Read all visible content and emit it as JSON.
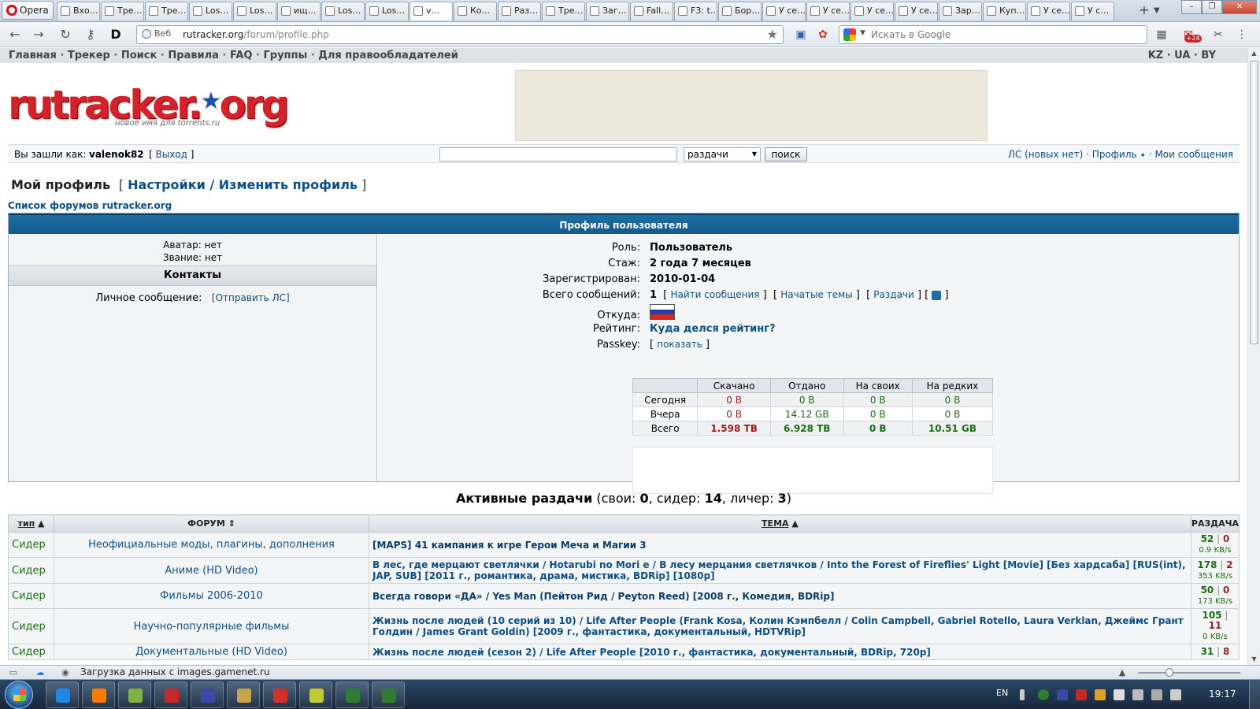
{
  "browser": {
    "menu_label": "Opera",
    "tabs": [
      "Вхо…",
      "Тре…",
      "Тре…",
      "Los…",
      "Los…",
      "ищ…",
      "Los…",
      "Los…",
      "v…",
      "Ко…",
      "Раз…",
      "Тре…",
      "Заг…",
      "Fall…",
      "F3: t…",
      "Бор…",
      "У се…",
      "У се…",
      "У се…",
      "У се…",
      "Зар…",
      "Куп…",
      "У се…",
      "У с…"
    ],
    "active_tab_index": 8,
    "address": {
      "prefix": "Веб",
      "host": "rutracker.org",
      "path": "/forum/profile.php"
    },
    "search_placeholder": "Искать в Google",
    "badge": "+24"
  },
  "topnav": {
    "items": [
      "Главная",
      "Трекер",
      "Поиск",
      "Правила",
      "FAQ",
      "Группы",
      "Для правообладателей"
    ],
    "separator": "·",
    "langs": "KZ · UA · BY"
  },
  "logo": {
    "text_main": "rutracker",
    "text_org": "org",
    "star": "★",
    "dot": ".",
    "tagline": "новое имя для torrents.ru"
  },
  "login": {
    "label": "Вы зашли как:",
    "username": "valenok82",
    "exit_open": "[",
    "exit_link": "Выход",
    "exit_close": "]",
    "search_value": "",
    "search_select": "раздачи",
    "search_button": "поиск",
    "pm_link": "ЛС (новых нет)",
    "profile_link": "Профиль",
    "my_messages_link": "Мои сообщения",
    "sep": "·"
  },
  "profile": {
    "heading": "Мой профиль",
    "settings_link": "Настройки / Изменить профиль",
    "forum_list_link": "Список форумов rutracker.org",
    "panel_title": "Профиль пользователя",
    "avatar": "Аватар: нет",
    "rank": "Звание: нет",
    "contacts_title": "Контакты",
    "pm_label": "Личное сообщение:",
    "pm_send": "[Отправить ЛС]",
    "rows": {
      "role_label": "Роль:",
      "role_value": "Пользователь",
      "exp_label": "Стаж:",
      "exp_value": "2 года 7 месяцев",
      "reg_label": "Зарегистрирован:",
      "reg_value": "2010-01-04",
      "posts_label": "Всего сообщений:",
      "posts_value": "1",
      "find_posts": "Найти сообщения",
      "started_topics": "Начатые темы",
      "releases": "Раздачи",
      "from_label": "Откуда:",
      "rating_label": "Рейтинг:",
      "rating_link": "Куда делся рейтинг?",
      "passkey_label": "Passkey:",
      "passkey_link": "показать"
    },
    "flag_colors": [
      "#ffffff",
      "#1f3fae",
      "#d52b1e"
    ]
  },
  "stats": {
    "headers": [
      "",
      "Скачано",
      "Отдано",
      "На своих",
      "На редких"
    ],
    "rows": [
      {
        "label": "Сегодня",
        "down": "0 B",
        "up": "0 B",
        "own": "0 B",
        "rare": "0 B"
      },
      {
        "label": "Вчера",
        "down": "0 B",
        "up": "14.12 GB",
        "own": "0 B",
        "rare": "0 B"
      },
      {
        "label": "Всего",
        "down": "1.598 TB",
        "up": "6.928 TB",
        "own": "0 B",
        "rare": "10.51 GB"
      }
    ]
  },
  "active": {
    "title": "Активные раздачи",
    "own_label": "свои:",
    "own": "0",
    "seeder_label": "сидер:",
    "seeder": "14",
    "leecher_label": "личер:",
    "leecher": "3",
    "columns": {
      "type": "тип",
      "forum": "ФОРУМ",
      "topic": "ТЕМА",
      "seed": "РАЗДАЧА"
    },
    "rows": [
      {
        "type": "Сидер",
        "forum": "Неофициальные моды, плагины, дополнения",
        "topic": "[MAPS] 41 кампания к игре Герои Меча и Магии 3",
        "seeds": "52",
        "leech": "0",
        "speed": "0.9 KB/s"
      },
      {
        "type": "Сидер",
        "forum": "Аниме (HD Video)",
        "topic": "В лес, где мерцают светлячки / Hotarubi no Mori e / В лесу мерцания светлячков / Into the Forest of Fireflies' Light [Movie] [Без хардсаба] [RUS(int), JAP, SUB] [2011 г., романтика, драма, мистика, BDRip] [1080p]",
        "seeds": "178",
        "leech": "2",
        "speed": "353 KB/s"
      },
      {
        "type": "Сидер",
        "forum": "Фильмы 2006-2010",
        "topic": "Всегда говори «ДА» / Yes Man (Пейтон Рид / Peyton Reed) [2008 г., Комедия, BDRip]",
        "seeds": "50",
        "leech": "0",
        "speed": "173 KB/s"
      },
      {
        "type": "Сидер",
        "forum": "Научно-популярные фильмы",
        "topic": "Жизнь после людей (10 серий из 10) / Life After People (Frank Kosa, Колин Кэмпбелл / Colin Campbell, Gabriel Rotello, Laura Verklan, Джеймс Грант Голдин / James Grant Goldin) [2009 г., фантастика, документальный, HDTVRip]",
        "seeds": "105",
        "leech": "11",
        "speed": "0 KB/s"
      },
      {
        "type": "Сидер",
        "forum": "Документальные (HD Video)",
        "topic": "Жизнь после людей (сезон 2) / Life After People [2010 г., фантастика, документальный, BDRip, 720p]",
        "seeds": "31",
        "leech": "8",
        "speed": ""
      }
    ]
  },
  "status": {
    "text": "Загрузка данных с images.gamenet.ru"
  },
  "taskbar": {
    "lang": "EN",
    "clock": "19:17",
    "app_colors": [
      "#1e88e5",
      "#ff7b00",
      "#7cb342",
      "#c62828",
      "#3949ab",
      "#c8a34a",
      "#d32f2f",
      "#c0ca33",
      "#2e7d32",
      "#2e7d32"
    ]
  },
  "colors": {
    "accent": "#155a8a",
    "link": "#0c4f84",
    "seed_green": "#1b6e13",
    "leech_red": "#9d1c1c",
    "logo_red": "#d4212a"
  }
}
